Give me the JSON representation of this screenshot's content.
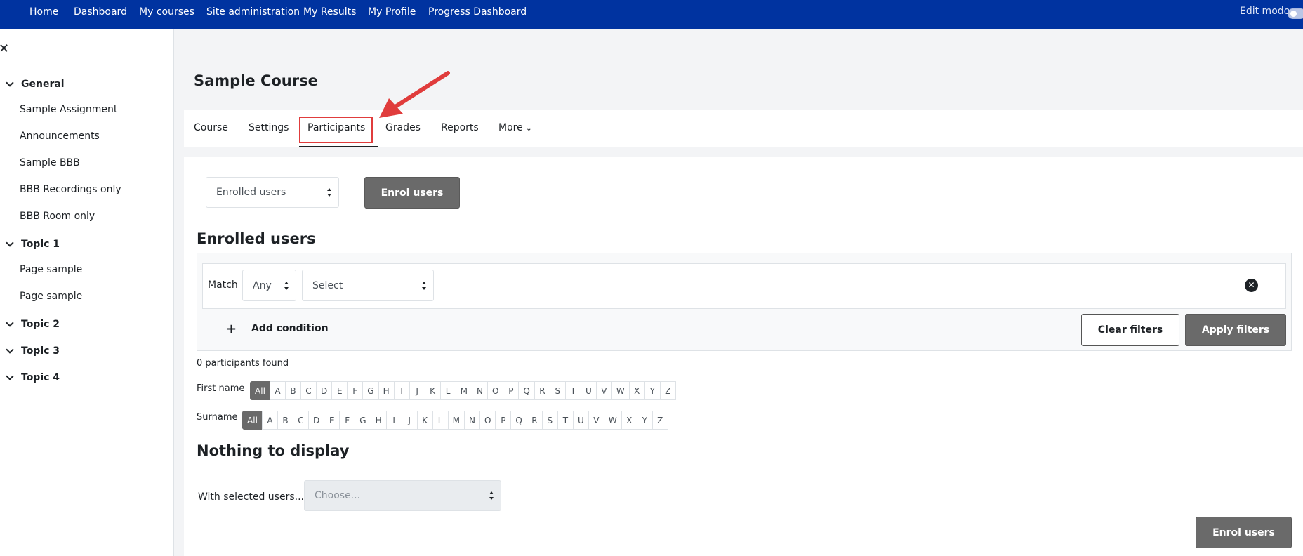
{
  "navbar": {
    "items": [
      "Home",
      "Dashboard",
      "My courses",
      "Site administration",
      "My Results",
      "My Profile",
      "Progress Dashboard"
    ],
    "edit_mode_label": "Edit mode",
    "bg_color": "#0033a0"
  },
  "drawer": {
    "close_icon": "close-icon",
    "sections": [
      {
        "label": "General",
        "activities": [
          "Sample Assignment",
          "Announcements",
          "Sample BBB",
          "BBB Recordings only",
          "BBB Room only"
        ]
      },
      {
        "label": "Topic 1",
        "activities": [
          "Page sample",
          "Page sample"
        ]
      },
      {
        "label": "Topic 2",
        "activities": []
      },
      {
        "label": "Topic 3",
        "activities": []
      },
      {
        "label": "Topic 4",
        "activities": []
      }
    ]
  },
  "course": {
    "title": "Sample Course",
    "tabs": [
      "Course",
      "Settings",
      "Participants",
      "Grades",
      "Reports",
      "More"
    ],
    "active_tab": "Participants"
  },
  "participants": {
    "enrol_select_value": "Enrolled users",
    "enrol_button": "Enrol users",
    "heading": "Enrolled users",
    "filter": {
      "match_label": "Match",
      "match_value": "Any",
      "type_value": "Select",
      "add_condition": "Add condition",
      "clear_filters": "Clear filters",
      "apply_filters": "Apply filters"
    },
    "found_text": "0 participants found",
    "first_name_label": "First name",
    "surname_label": "Surname",
    "letters": [
      "All",
      "A",
      "B",
      "C",
      "D",
      "E",
      "F",
      "G",
      "H",
      "I",
      "J",
      "K",
      "L",
      "M",
      "N",
      "O",
      "P",
      "Q",
      "R",
      "S",
      "T",
      "U",
      "V",
      "W",
      "X",
      "Y",
      "Z"
    ],
    "nothing_heading": "Nothing to display",
    "with_selected_label": "With selected users...",
    "choose_placeholder": "Choose...",
    "bottom_enrol_button": "Enrol users"
  },
  "annotation": {
    "highlight_color": "#e03c3c"
  }
}
